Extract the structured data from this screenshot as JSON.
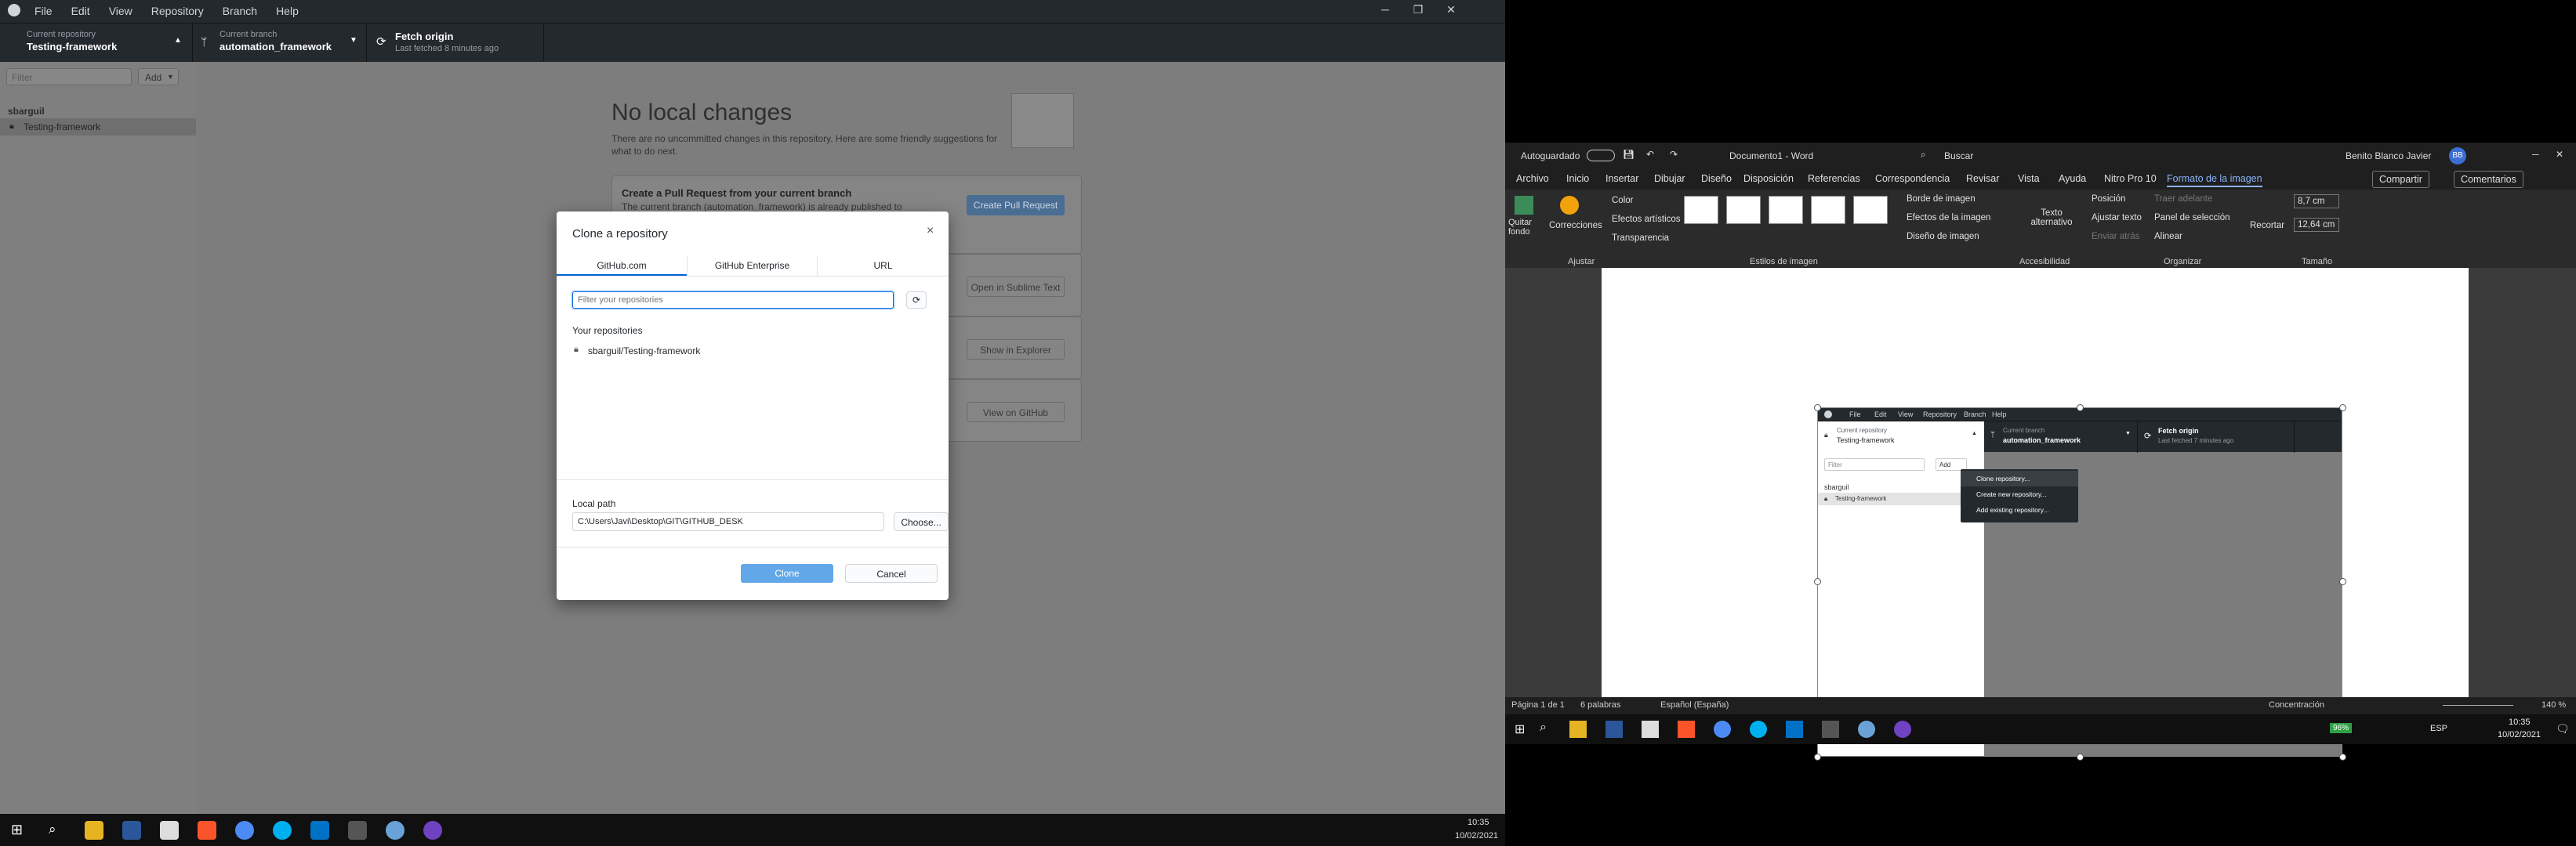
{
  "github_desktop": {
    "menu": [
      "File",
      "Edit",
      "View",
      "Repository",
      "Branch",
      "Help"
    ],
    "current_repo_label": "Current repository",
    "current_repo": "Testing-framework",
    "current_branch_label": "Current branch",
    "current_branch": "automation_framework",
    "fetch_label": "Fetch origin",
    "fetch_sub": "Last fetched 8 minutes ago",
    "filter_placeholder": "Filter",
    "add_label": "Add",
    "owner": "sbarguil",
    "repo_item": "Testing-framework",
    "no_changes_title": "No local changes",
    "no_changes_text": "There are no uncommitted changes in this repository. Here are some friendly suggestions for what to do next.",
    "pr_title": "Create a Pull Request from your current branch",
    "pr_text": "The current branch (automation_framework) is already published to",
    "pr_button": "Create Pull Request",
    "open_editor": "Open in Sublime Text",
    "show_explorer": "Show in Explorer",
    "view_github": "View on GitHub"
  },
  "clone_dialog": {
    "title": "Clone a repository",
    "tabs": [
      "GitHub.com",
      "GitHub Enterprise",
      "URL"
    ],
    "filter_placeholder": "Filter your repositories",
    "your_repos_label": "Your repositories",
    "repos": [
      "sbarguil/Testing-framework"
    ],
    "local_path_label": "Local path",
    "local_path_value": "C:\\Users\\Javi\\Desktop\\GIT\\GITHUB_DESK",
    "choose_label": "Choose...",
    "clone_label": "Clone",
    "cancel_label": "Cancel"
  },
  "left_taskbar": {
    "time": "10:35",
    "date": "10/02/2021"
  },
  "word": {
    "autosave_label": "Autoguardado",
    "doc_title": "Documento1 - Word",
    "search_label": "Buscar",
    "user_name": "Benito Blanco Javier",
    "user_initials": "BB",
    "tabs": [
      "Archivo",
      "Inicio",
      "Insertar",
      "Dibujar",
      "Diseño",
      "Disposición",
      "Referencias",
      "Correspondencia",
      "Revisar",
      "Vista",
      "Ayuda",
      "Nitro Pro 10",
      "Formato de la imagen"
    ],
    "share_label": "Compartir",
    "comments_label": "Comentarios",
    "ribbon": {
      "quitar_fondo": "Quitar fondo",
      "correcciones": "Correcciones",
      "color": "Color",
      "efectos_artisticos": "Efectos artísticos",
      "transparencia": "Transparencia",
      "group_ajustar": "Ajustar",
      "borde_imagen": "Borde de imagen",
      "efectos_imagen": "Efectos de la imagen",
      "diseno_imagen": "Diseño de imagen",
      "group_estilos": "Estilos de imagen",
      "texto_alternativo": "Texto alternativo",
      "group_accesibilidad": "Accesibilidad",
      "posicion": "Posición",
      "ajustar_texto": "Ajustar texto",
      "traer_adelante": "Traer adelante",
      "enviar_atras": "Enviar atrás",
      "panel_seleccion": "Panel de selección",
      "alinear": "Alinear",
      "group_organizar": "Organizar",
      "recortar": "Recortar",
      "height": "8,7 cm",
      "width": "12,64 cm",
      "group_tamano": "Tamaño"
    },
    "embedded": {
      "menu": [
        "File",
        "Edit",
        "View",
        "Repository",
        "Branch",
        "Help"
      ],
      "current_repo_label": "Current repository",
      "current_repo": "Testing-framework",
      "current_branch_label": "Current branch",
      "current_branch": "automation_framework",
      "fetch_label": "Fetch origin",
      "fetch_sub": "Last fetched 7 minutes ago",
      "filter_placeholder": "Filter",
      "add_label": "Add",
      "owner": "sbarguil",
      "repo_item": "Testing-framework",
      "add_menu": [
        "Clone repository...",
        "Create new repository...",
        "Add existing repository..."
      ]
    },
    "status": {
      "page": "Página 1 de 1",
      "words": "6 palabras",
      "language": "Español (España)",
      "focus": "Concentración",
      "zoom": "140 %"
    },
    "taskbar": {
      "battery": "96%",
      "lang": "ESP",
      "time": "10:35",
      "date": "10/02/2021"
    }
  }
}
